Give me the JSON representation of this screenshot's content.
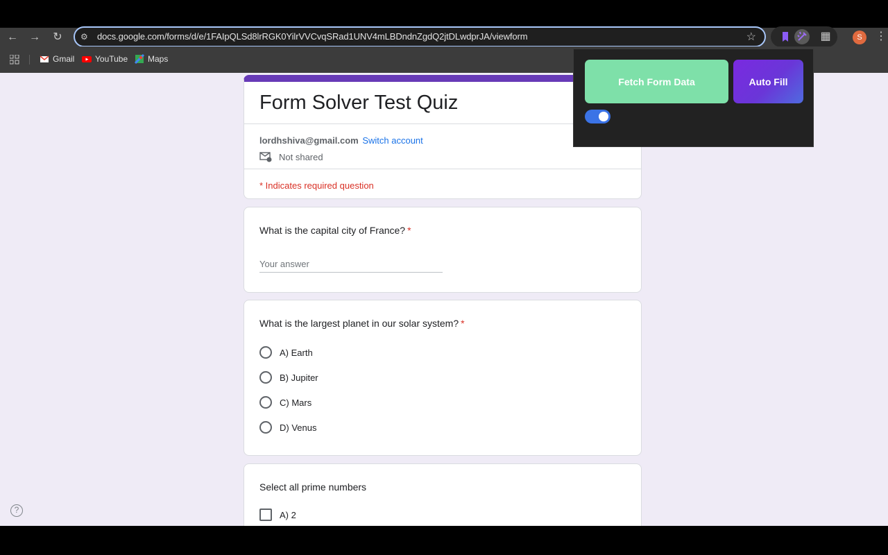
{
  "browser": {
    "url": "docs.google.com/forms/d/e/1FAIpQLSd8lrRGK0YilrVVCvqSRad1UNV4mLBDndnZgdQ2jtDLwdprJA/viewform",
    "profile_initial": "S",
    "bookmarks": [
      {
        "label": "Gmail",
        "icon": "gmail-icon"
      },
      {
        "label": "YouTube",
        "icon": "youtube-icon"
      },
      {
        "label": "Maps",
        "icon": "maps-icon"
      }
    ]
  },
  "extension_popup": {
    "fetch_label": "Fetch Form Data",
    "autofill_label": "Auto Fill",
    "toggle_on": true,
    "colors": {
      "fetch": "#7ee0a9",
      "autofill_start": "#7a2ae0",
      "autofill_end": "#4f6bdf",
      "toggle": "#3b73e6"
    }
  },
  "form": {
    "title": "Form Solver Test Quiz",
    "account_email": "lordhshiva@gmail.com",
    "switch_account": "Switch account",
    "not_shared": "Not shared",
    "required_note": "* Indicates required question",
    "questions": [
      {
        "title": "What is the capital city of France?",
        "required": "*",
        "placeholder": "Your answer"
      },
      {
        "title": "What is the largest planet in our solar system?",
        "required": "*",
        "options": [
          "A) Earth",
          "B) Jupiter",
          "C) Mars",
          "D) Venus"
        ]
      },
      {
        "title": "Select all prime numbers",
        "options": [
          "A) 2"
        ]
      }
    ]
  }
}
